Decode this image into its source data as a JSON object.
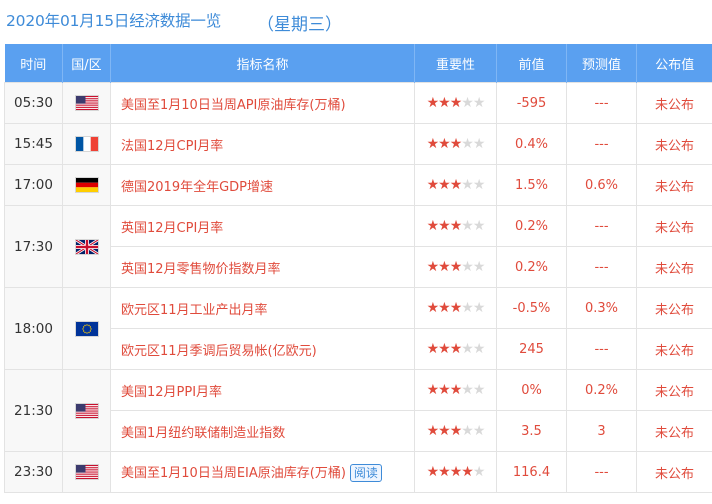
{
  "page": {
    "title": "2020年01月15日经济数据一览",
    "weekday": "（星期三）"
  },
  "columns": {
    "time": "时间",
    "country": "国/区",
    "indicator": "指标名称",
    "importance": "重要性",
    "previous": "前值",
    "forecast": "预测值",
    "actual": "公布值"
  },
  "groups": [
    {
      "time": "05:30",
      "country": "美国",
      "flag_icon": "us-flag-icon",
      "rows": [
        {
          "name": "美国至1月10日当周API原油库存(万桶)",
          "importance": 3,
          "previous": "-595",
          "forecast": "---",
          "actual": "未公布"
        }
      ]
    },
    {
      "time": "15:45",
      "country": "法国",
      "flag_icon": "fr-flag-icon",
      "rows": [
        {
          "name": "法国12月CPI月率",
          "importance": 3,
          "previous": "0.4%",
          "forecast": "---",
          "actual": "未公布"
        }
      ]
    },
    {
      "time": "17:00",
      "country": "德国",
      "flag_icon": "de-flag-icon",
      "rows": [
        {
          "name": "德国2019年全年GDP增速",
          "importance": 3,
          "previous": "1.5%",
          "forecast": "0.6%",
          "actual": "未公布"
        }
      ]
    },
    {
      "time": "17:30",
      "country": "英国",
      "flag_icon": "gb-flag-icon",
      "rows": [
        {
          "name": "英国12月CPI月率",
          "importance": 3,
          "previous": "0.2%",
          "forecast": "---",
          "actual": "未公布"
        },
        {
          "name": "英国12月零售物价指数月率",
          "importance": 3,
          "previous": "0.2%",
          "forecast": "---",
          "actual": "未公布"
        }
      ]
    },
    {
      "time": "18:00",
      "country": "欧元区",
      "flag_icon": "eu-flag-icon",
      "rows": [
        {
          "name": "欧元区11月工业产出月率",
          "importance": 3,
          "previous": "-0.5%",
          "forecast": "0.3%",
          "actual": "未公布"
        },
        {
          "name": "欧元区11月季调后贸易帐(亿欧元)",
          "importance": 3,
          "previous": "245",
          "forecast": "---",
          "actual": "未公布"
        }
      ]
    },
    {
      "time": "21:30",
      "country": "美国",
      "flag_icon": "us-flag-icon",
      "rows": [
        {
          "name": "美国12月PPI月率",
          "importance": 3,
          "previous": "0%",
          "forecast": "0.2%",
          "actual": "未公布"
        },
        {
          "name": "美国1月纽约联储制造业指数",
          "importance": 3,
          "previous": "3.5",
          "forecast": "3",
          "actual": "未公布"
        }
      ]
    },
    {
      "time": "23:30",
      "country": "美国",
      "flag_icon": "us-flag-icon",
      "rows": [
        {
          "name": "美国至1月10日当周EIA原油库存(万桶)",
          "importance": 4,
          "previous": "116.4",
          "forecast": "---",
          "actual": "未公布",
          "read_label": "阅读"
        }
      ]
    }
  ],
  "colors": {
    "header_bg": "#5aa0f0",
    "title": "#3e8bd8",
    "value_red": "#e04b3c",
    "star_off": "#d9d9d9"
  }
}
